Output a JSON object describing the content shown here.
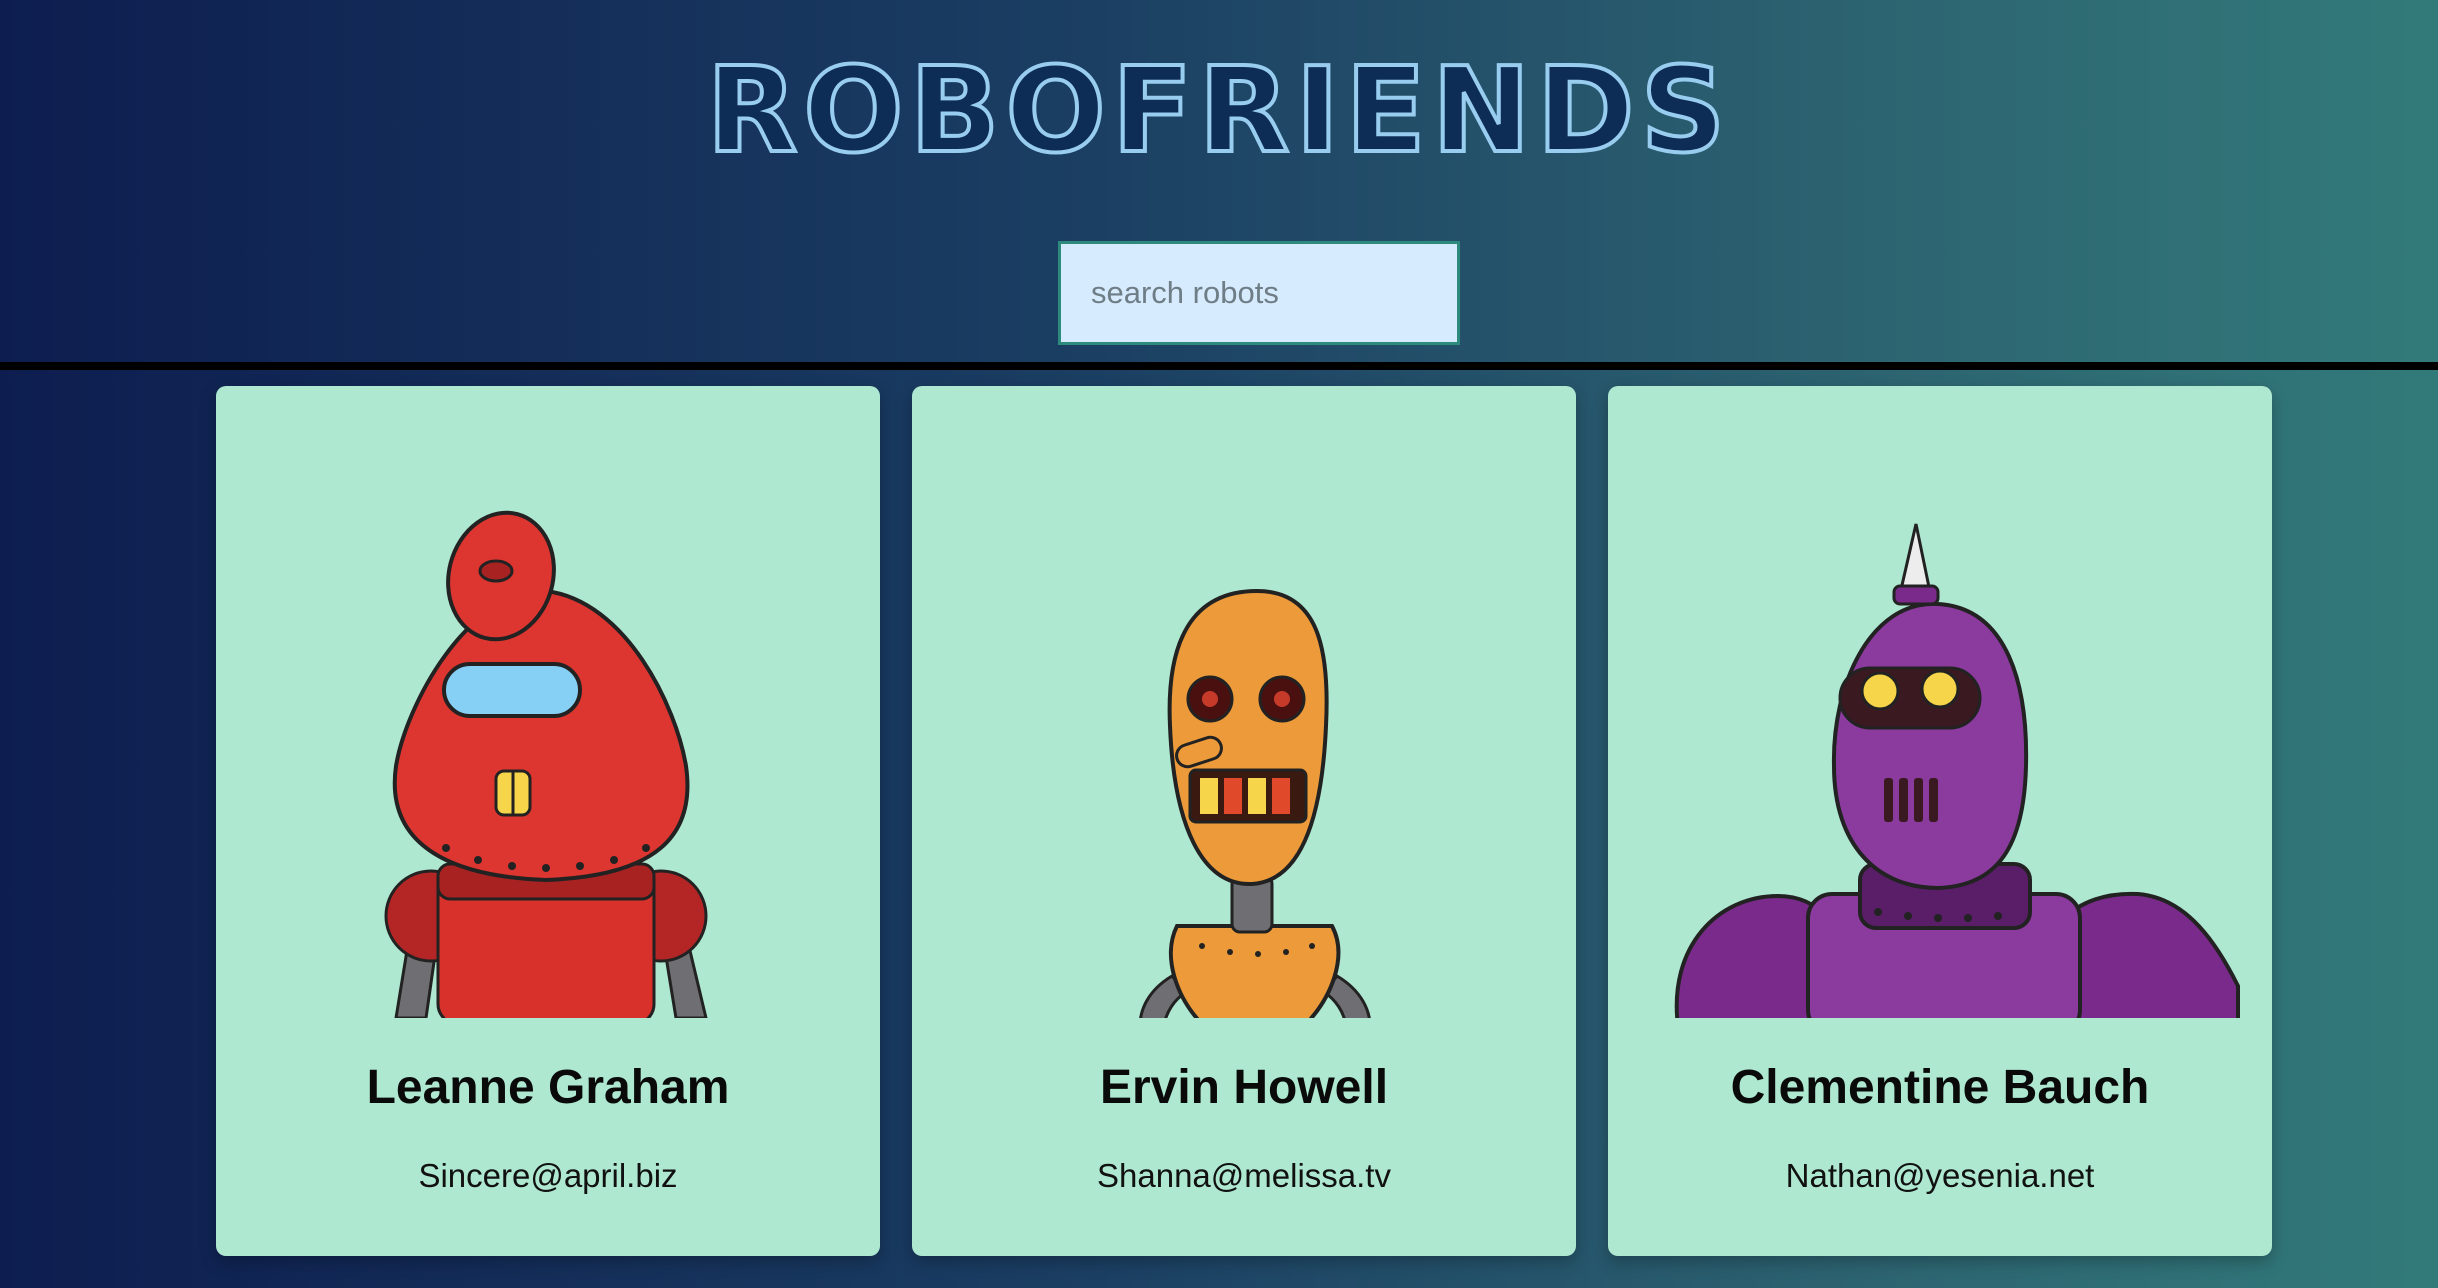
{
  "header": {
    "title": "ROBOFRIENDS",
    "search": {
      "placeholder": "search robots",
      "value": ""
    }
  },
  "colors": {
    "background_start": "#0d1d4f",
    "background_end": "#327a7a",
    "title_outline": "#98cdef",
    "search_bg": "#d6ebfd",
    "card_bg": "#aee8d1",
    "divider": "#000000"
  },
  "robots": [
    {
      "name": "Leanne Graham",
      "email": "Sincere@april.biz",
      "avatar": "red-robot-avatar"
    },
    {
      "name": "Ervin Howell",
      "email": "Shanna@melissa.tv",
      "avatar": "orange-robot-avatar"
    },
    {
      "name": "Clementine Bauch",
      "email": "Nathan@yesenia.net",
      "avatar": "purple-robot-avatar"
    }
  ]
}
